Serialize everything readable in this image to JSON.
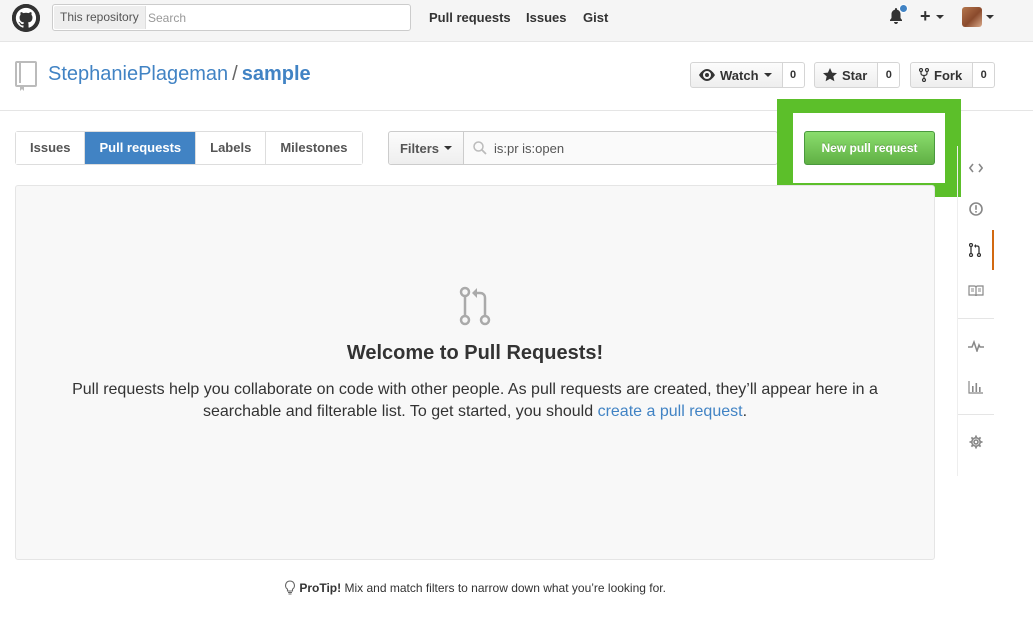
{
  "header": {
    "search_scope": "This repository",
    "search_placeholder": "Search",
    "nav": [
      "Pull requests",
      "Issues",
      "Gist"
    ],
    "plus_symbol": "+",
    "icons": [
      "github-logo-icon",
      "bell-icon",
      "plus-icon",
      "avatar"
    ]
  },
  "repo": {
    "owner": "StephaniePlageman",
    "separator": "/",
    "name": "sample",
    "watch_label": "Watch",
    "watch_count": "0",
    "star_label": "Star",
    "star_count": "0",
    "fork_label": "Fork",
    "fork_count": "0"
  },
  "subnav": {
    "items": [
      "Issues",
      "Pull requests",
      "Labels",
      "Milestones"
    ],
    "selected": "Pull requests"
  },
  "filter": {
    "button_label": "Filters",
    "query": "is:pr is:open"
  },
  "new_pr_button": "New pull request",
  "blankslate": {
    "title": "Welcome to Pull Requests!",
    "text_before_link": "Pull requests help you collaborate on code with other people. As pull requests are created, they’ll appear here in a searchable and filterable list. To get started, you should ",
    "link_text": "create a pull request",
    "text_after_link": "."
  },
  "protip": {
    "label": "ProTip!",
    "text": " Mix and match filters to narrow down what you’re looking for."
  },
  "sidebar_icons": [
    "code-icon",
    "issue-opened-icon",
    "pull-request-icon",
    "wiki-book-icon",
    "pulse-icon",
    "graph-icon",
    "gear-icon"
  ],
  "colors": {
    "accent_blue": "#4183c4",
    "highlight_green": "#5cbf2a",
    "button_green": "#60b044",
    "selected_tab_orange": "#d26911"
  }
}
